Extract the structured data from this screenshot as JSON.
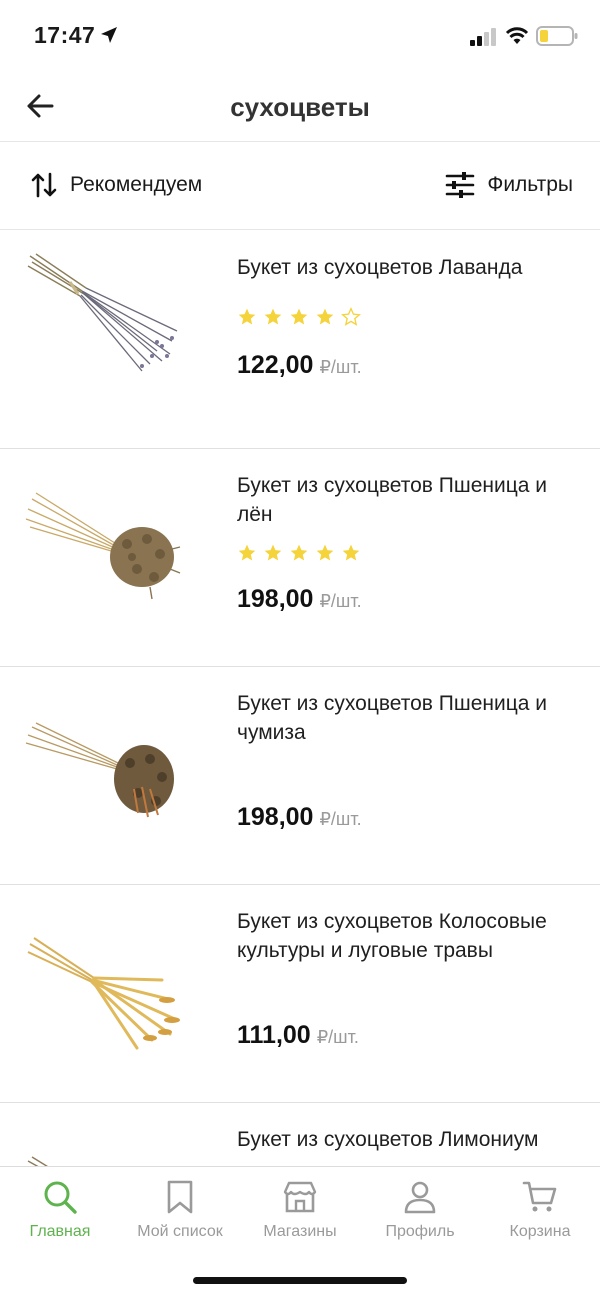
{
  "status_bar": {
    "time": "17:47"
  },
  "header": {
    "title": "сухоцветы"
  },
  "toolbar": {
    "sort_label": "Рекомендуем",
    "filter_label": "Фильтры"
  },
  "products": [
    {
      "name": "Букет из сухоцветов Лаванда",
      "rating": 4,
      "max_rating": 5,
      "price": "122,00",
      "unit": "₽/шт.",
      "image_icon": "lavender-bouquet"
    },
    {
      "name": "Букет из сухоцветов Пшеница и лён",
      "rating": 5,
      "max_rating": 5,
      "price": "198,00",
      "unit": "₽/шт.",
      "image_icon": "wheat-flax-bouquet"
    },
    {
      "name": "Букет из сухоцветов Пшеница и чумиза",
      "rating": null,
      "max_rating": 5,
      "price": "198,00",
      "unit": "₽/шт.",
      "image_icon": "wheat-millet-bouquet"
    },
    {
      "name": "Букет из сухоцветов Колосовые культуры и луговые травы",
      "rating": null,
      "max_rating": 5,
      "price": "111,00",
      "unit": "₽/шт.",
      "image_icon": "grain-grass-bouquet"
    },
    {
      "name": "Букет из сухоцветов Лимониум",
      "rating": null,
      "max_rating": 5,
      "price": "",
      "unit": "",
      "image_icon": "limonium-bouquet"
    }
  ],
  "tab_bar": {
    "tabs": [
      {
        "label": "Главная",
        "icon": "search-icon",
        "active": true
      },
      {
        "label": "Мой список",
        "icon": "bookmark-icon",
        "active": false
      },
      {
        "label": "Магазины",
        "icon": "store-icon",
        "active": false
      },
      {
        "label": "Профиль",
        "icon": "profile-icon",
        "active": false
      },
      {
        "label": "Корзина",
        "icon": "cart-icon",
        "active": false
      }
    ]
  },
  "colors": {
    "accent": "#5fb34f",
    "star": "#f5d33a",
    "muted": "#9a9a9a"
  }
}
